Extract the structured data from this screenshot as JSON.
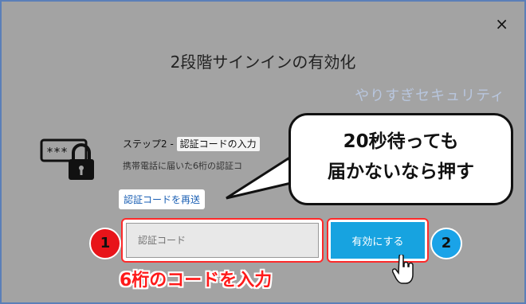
{
  "dialog": {
    "title": "2段階サインインの有効化",
    "close_label": "×",
    "watermark": "やりすぎセキュリティ"
  },
  "step": {
    "prefix": "ステップ2 - ",
    "name": "認証コードの入力",
    "description": "携帯電話に届いた6桁の認証コ"
  },
  "resend_link": "認証コードを再送",
  "code_input": {
    "placeholder": "認証コード",
    "value": ""
  },
  "enable_button": "有効にする",
  "annotations": {
    "bubble_line1": "20秒待っても",
    "bubble_line2": "届かないなら押す",
    "badge1": "1",
    "badge2": "2",
    "caption": "6桁のコードを入力"
  },
  "colors": {
    "accent_blue": "#17a3e0",
    "highlight_red": "#ff2a2a"
  },
  "icons": [
    "close-icon",
    "password-lock-icon",
    "hand-cursor-icon"
  ]
}
